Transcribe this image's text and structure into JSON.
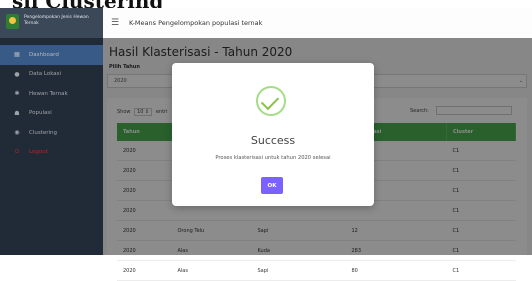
{
  "page_heading_cut": "sil Clustering",
  "brand": {
    "text": "Pengelompokan Jenis Hewan Ternak"
  },
  "sidebar": {
    "items": [
      {
        "label": "Dashboard",
        "icon": "grid-icon"
      },
      {
        "label": "Data Lokasi",
        "icon": "map-pin-icon"
      },
      {
        "label": "Hewan Ternak",
        "icon": "paw-icon"
      },
      {
        "label": "Populasi",
        "icon": "users-icon"
      },
      {
        "label": "Clustering",
        "icon": "database-icon"
      },
      {
        "label": "Logout",
        "icon": "power-icon"
      }
    ]
  },
  "topbar": {
    "title": "K-Means Pengelompokan populasi ternak"
  },
  "main": {
    "title": "Hasil Klasterisasi - Tahun 2020",
    "filter_label": "Pilih Tahun",
    "selected_year": "2020",
    "show_prefix": "Show",
    "show_value": "10",
    "show_suffix": "entri",
    "search_label": "Search:"
  },
  "table": {
    "headers": [
      "Tahun",
      "",
      "",
      "h Populasi",
      "Cluster"
    ],
    "rows": [
      [
        "2020",
        "",
        "",
        "",
        "C1"
      ],
      [
        "2020",
        "",
        "",
        "",
        "C1"
      ],
      [
        "2020",
        "",
        "",
        "",
        "C1"
      ],
      [
        "2020",
        "",
        "",
        "",
        "C1"
      ],
      [
        "2020",
        "Orong Telu",
        "Sapi",
        "12",
        "C1"
      ],
      [
        "2020",
        "Alas",
        "Kuda",
        "283",
        "C1"
      ],
      [
        "2020",
        "Alas",
        "Sapi",
        "80",
        "C1"
      ]
    ]
  },
  "modal": {
    "title": "Success",
    "message": "Proses klasterisasi untuk tahun 2020 selesai",
    "ok_label": "OK"
  },
  "colors": {
    "sidebar_bg": "#2d3a4a",
    "active_item": "#4a78b5",
    "table_header": "#4caf50",
    "ok_button": "#7b61ff",
    "success_check": "#8bc34a"
  }
}
